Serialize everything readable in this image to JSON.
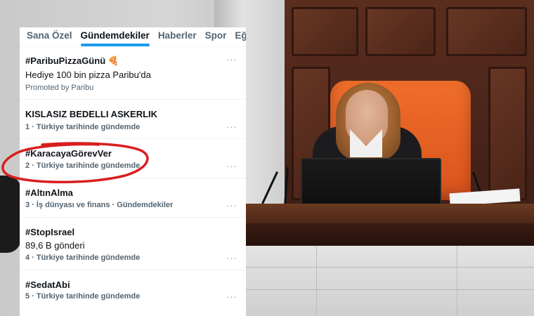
{
  "tabs": [
    {
      "label": "Sana Özel"
    },
    {
      "label": "Gündemdekiler",
      "active": true
    },
    {
      "label": "Haberler"
    },
    {
      "label": "Spor"
    },
    {
      "label": "Eğlence"
    }
  ],
  "more_label": "···",
  "promoted_trend": {
    "title": "#ParibuPizzaGünü",
    "emoji": "🍕",
    "subtitle": "Hediye 100 bin pizza Paribu'da",
    "promoted": "Promoted by Paribu"
  },
  "trends": [
    {
      "title": "KISLASIZ BEDELLI ASKERLIK",
      "meta": "1 · Türkiye tarihinde gündemde"
    },
    {
      "title": "#KaracayaGörevVer",
      "meta": "2 · Türkiye tarihinde gündemde"
    },
    {
      "title": "#AltınAlma",
      "meta": "3 · İş dünyası ve finans · Gündemdekiler"
    },
    {
      "title": "#StopIsrael",
      "posts": "89,6 B gönderi",
      "meta": "4 · Türkiye tarihinde gündemde"
    },
    {
      "title": "#SedatAbi",
      "meta": "5 · Türkiye tarihinde gündemde"
    }
  ],
  "colors": {
    "accent": "#1d9bf0",
    "highlight_circle": "#d81e1e"
  },
  "icons": {
    "pizza": "pizza-icon",
    "more": "more-icon",
    "circle": "highlight-circle"
  }
}
